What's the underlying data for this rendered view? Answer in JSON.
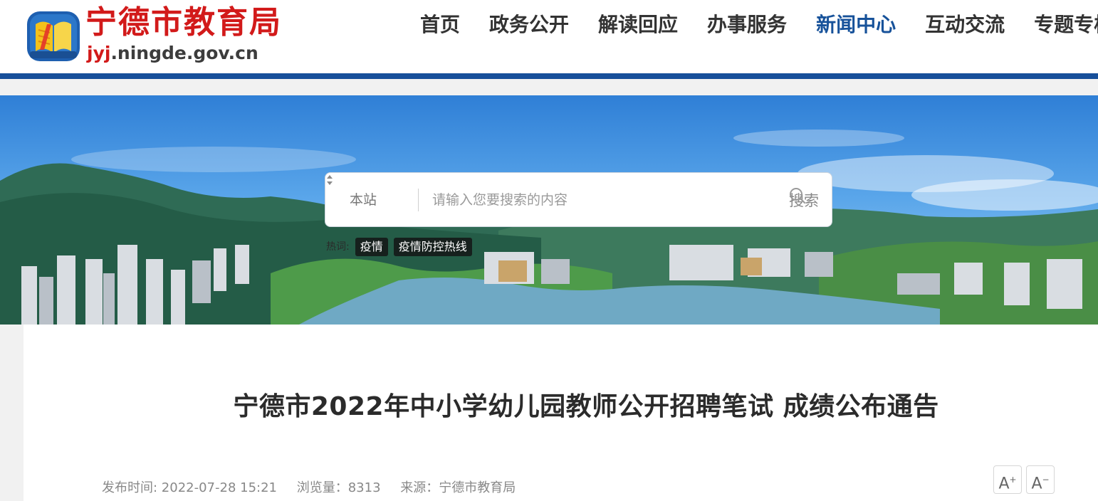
{
  "header": {
    "logo_title": "宁德市教育局",
    "logo_domain_highlight": "jyj",
    "logo_domain_rest": ".ningde.gov.cn",
    "nav": [
      {
        "label": "首页",
        "active": false
      },
      {
        "label": "政务公开",
        "active": false
      },
      {
        "label": "解读回应",
        "active": false
      },
      {
        "label": "办事服务",
        "active": false
      },
      {
        "label": "新闻中心",
        "active": true
      },
      {
        "label": "互动交流",
        "active": false
      },
      {
        "label": "专题专栏",
        "active": false
      }
    ]
  },
  "search": {
    "scope": "本站",
    "placeholder": "请输入您要搜索的内容",
    "button_label": "搜索",
    "hot_label": "热词:",
    "hot_tags": [
      "疫情",
      "疫情防控热线"
    ]
  },
  "article": {
    "title": "宁德市2022年中小学幼儿园教师公开招聘笔试 成绩公布通告",
    "publish_time": "发布时间: 2022-07-28 15:21",
    "views": "浏览量：8313",
    "source": "来源：宁德市教育局",
    "font_increase": "A",
    "font_decrease": "A"
  },
  "colors": {
    "brand_red": "#d21a1a",
    "nav_active": "#17529a",
    "header_bar": "#174f9a"
  }
}
